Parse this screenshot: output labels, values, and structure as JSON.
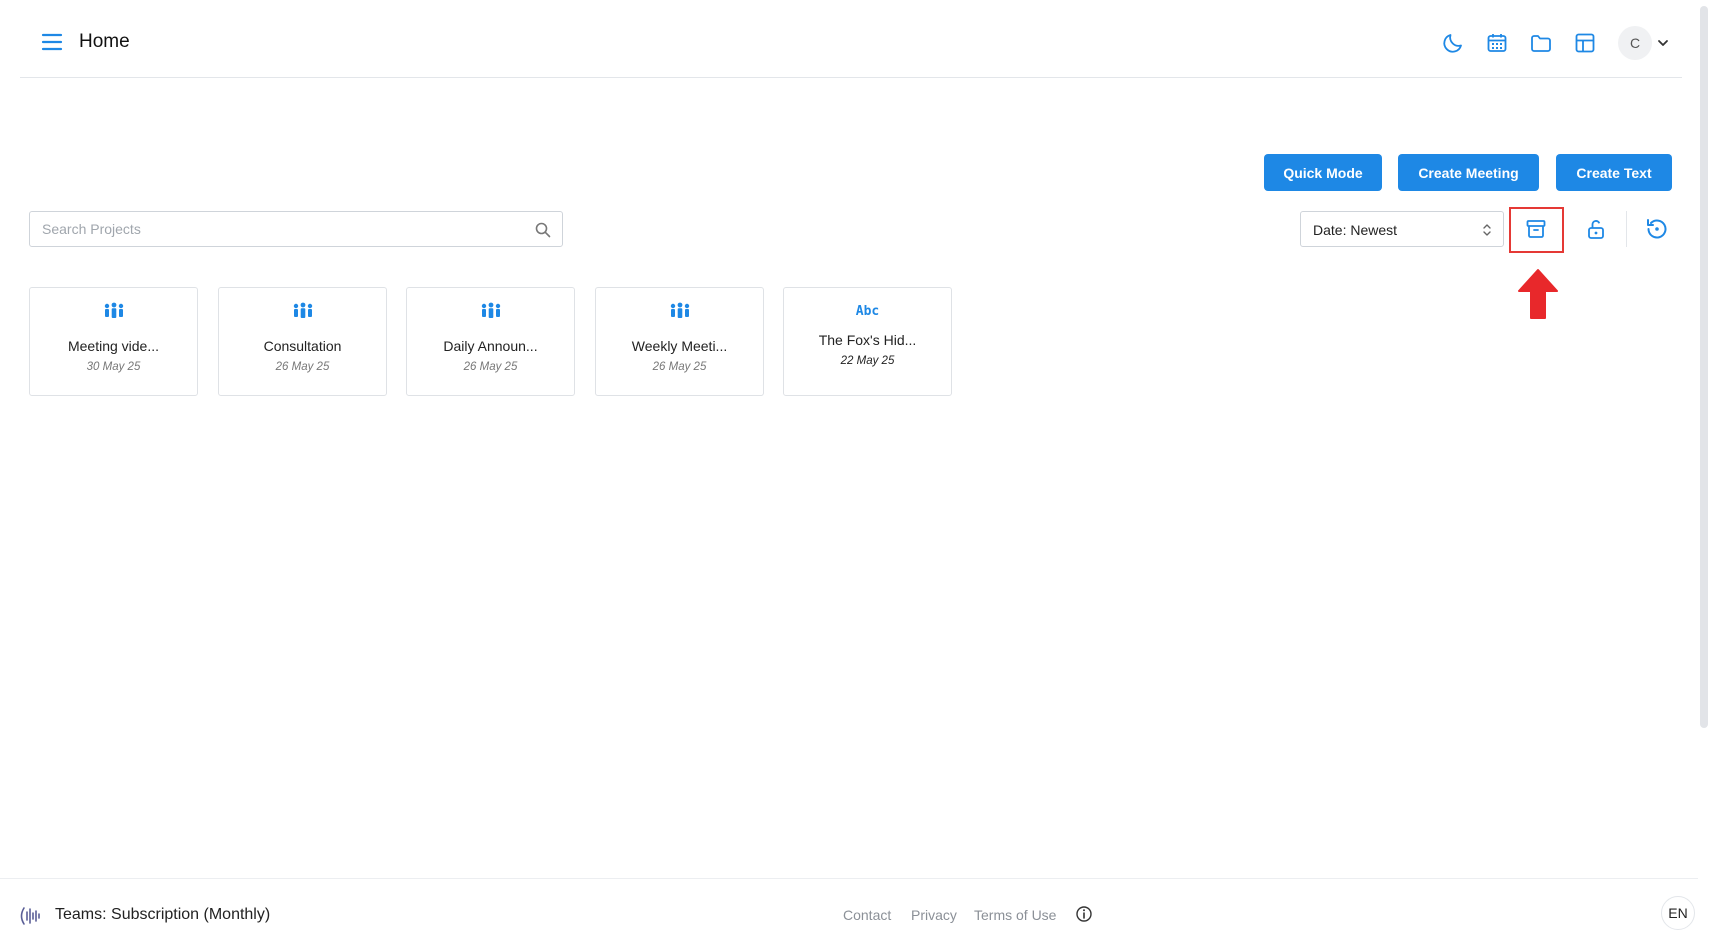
{
  "header": {
    "title": "Home",
    "avatar_initial": "C",
    "icons": [
      "menu-icon",
      "moon-icon",
      "calendar-icon",
      "folder-icon",
      "layout-grid-icon",
      "chevron-down-icon"
    ]
  },
  "actions": {
    "quick_mode": "Quick Mode",
    "create_meeting": "Create Meeting",
    "create_text": "Create Text"
  },
  "search": {
    "placeholder": "Search Projects",
    "value": ""
  },
  "sort": {
    "selected": "Date: Newest"
  },
  "toolbar_icons": [
    "archive-icon",
    "unlock-icon",
    "history-icon"
  ],
  "projects": [
    {
      "title": "Meeting vide...",
      "date": "30 May 25",
      "type": "meeting"
    },
    {
      "title": "Consultation",
      "date": "26 May 25",
      "type": "meeting"
    },
    {
      "title": "Daily Announ...",
      "date": "26 May 25",
      "type": "meeting"
    },
    {
      "title": "Weekly Meeti...",
      "date": "26 May 25",
      "type": "meeting"
    },
    {
      "title": "The Fox's Hid...",
      "date": "22 May 25",
      "type": "text",
      "icon_text": "Abc"
    }
  ],
  "footer": {
    "plan": "Teams: Subscription (Monthly)",
    "links": [
      "Contact",
      "Privacy",
      "Terms of Use"
    ],
    "language": "EN"
  },
  "colors": {
    "accent": "#1e88e5",
    "highlight": "#e53935"
  }
}
